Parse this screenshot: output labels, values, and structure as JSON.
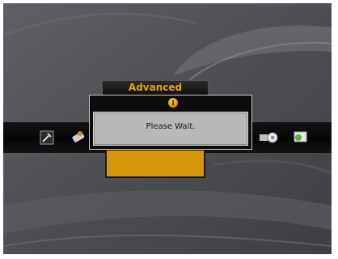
{
  "menu": {
    "active_tab_label": "Advanced",
    "icons": [
      {
        "name": "tools-icon"
      },
      {
        "name": "remote-icon"
      },
      {
        "name": "film-reel-icon"
      },
      {
        "name": "monitor-icon"
      }
    ]
  },
  "dialog": {
    "message": "Please Wait."
  },
  "colors": {
    "accent": "#d4960a",
    "tab_text": "#f0a000",
    "dialog_bg": "#b8b8b8",
    "screen_bg": "#4a4b4f"
  }
}
